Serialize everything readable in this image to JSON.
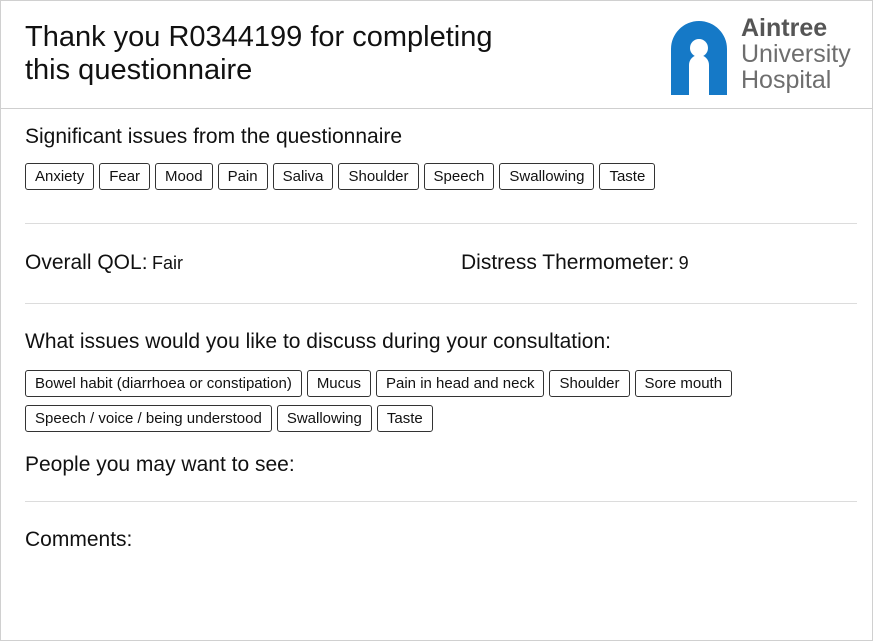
{
  "header": {
    "title_line1": "Thank you R0344199 for completing",
    "title_line2": "this questionnaire",
    "logo": {
      "line1": "Aintree",
      "line2": "University",
      "line3": "Hospital",
      "color": "#1579c7",
      "icon": "hospital-logo-icon"
    }
  },
  "significant": {
    "heading": "Significant issues from the questionnaire",
    "items": [
      "Anxiety",
      "Fear",
      "Mood",
      "Pain",
      "Saliva",
      "Shoulder",
      "Speech",
      "Swallowing",
      "Taste"
    ]
  },
  "scores": {
    "qol_label": "Overall QOL:",
    "qol_value": "Fair",
    "distress_label": "Distress Thermometer:",
    "distress_value": "9"
  },
  "discuss": {
    "heading": "What issues would you like to discuss during your consultation:",
    "row1": [
      "Bowel habit (diarrhoea or constipation)",
      "Mucus",
      "Pain in head and neck",
      "Shoulder",
      "Sore mouth"
    ],
    "row2": [
      "Speech / voice / being understood",
      "Swallowing",
      "Taste"
    ]
  },
  "people": {
    "heading": "People you may want to see:"
  },
  "comments": {
    "heading": "Comments:"
  }
}
